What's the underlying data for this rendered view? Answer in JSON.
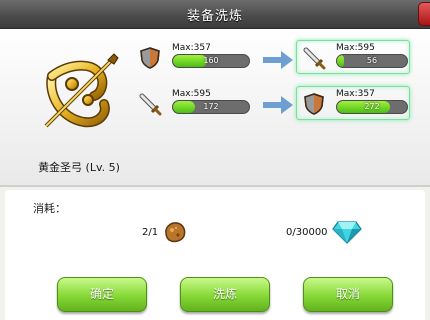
{
  "title": "装备洗炼",
  "item": {
    "name": "黄金圣弓 (Lv. 5)"
  },
  "current_stats": [
    {
      "icon": "shield-icon",
      "max": "Max:357",
      "value": "160",
      "fraction": 0.448
    },
    {
      "icon": "sword-icon",
      "max": "Max:595",
      "value": "172",
      "fraction": 0.289
    }
  ],
  "new_stats": [
    {
      "icon": "sword-icon",
      "max": "Max:595",
      "value": "56",
      "fraction": 0.094
    },
    {
      "icon": "shield-icon",
      "max": "Max:357",
      "value": "272",
      "fraction": 0.762
    }
  ],
  "cost": {
    "label": "消耗：",
    "ore": {
      "icon": "ore-icon",
      "amount": "2/1"
    },
    "gem": {
      "icon": "diamond-icon",
      "amount": "0/30000"
    }
  },
  "buttons": {
    "confirm": "确定",
    "refine": "洗炼",
    "cancel": "取消"
  },
  "colors": {
    "bar_fill": "#6ed626",
    "button": "#86d836",
    "title_bar": "#4a4a4a",
    "close": "#c12020"
  }
}
